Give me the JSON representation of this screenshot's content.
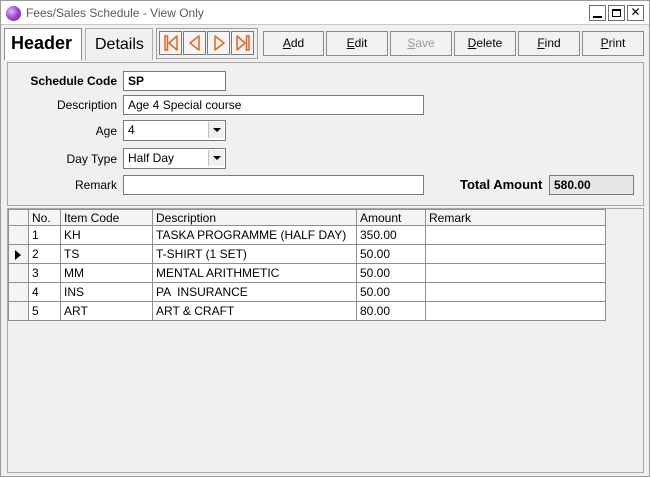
{
  "window": {
    "title": "Fees/Sales Schedule - View Only",
    "controls": [
      "minimize",
      "maximize",
      "close"
    ]
  },
  "tabs": [
    {
      "label": "Header",
      "active": true
    },
    {
      "label": "Details",
      "active": false
    }
  ],
  "navigation": {
    "icons": [
      "first-record-icon",
      "previous-record-icon",
      "next-record-icon",
      "last-record-icon"
    ],
    "icon_color": "#e8641b"
  },
  "toolbar": {
    "add": {
      "label_ul": "A",
      "label_rest": "dd"
    },
    "edit": {
      "label_ul": "E",
      "label_rest": "dit"
    },
    "save": {
      "label_ul": "S",
      "label_rest": "ave",
      "disabled": true
    },
    "delete": {
      "label_ul": "D",
      "label_rest": "elete"
    },
    "find": {
      "label_ul": "F",
      "label_rest": "ind"
    },
    "print": {
      "label_ul": "P",
      "label_rest": "rint"
    }
  },
  "form": {
    "schedule_code": {
      "label": "Schedule Code",
      "value": "SP"
    },
    "description": {
      "label": "Description",
      "value": "Age 4 Special course"
    },
    "age": {
      "label": "Age",
      "value": "4"
    },
    "day_type": {
      "label": "Day Type",
      "value": "Half Day"
    },
    "remark": {
      "label": "Remark",
      "value": ""
    },
    "total_amount": {
      "label": "Total Amount",
      "value": "580.00"
    }
  },
  "grid": {
    "columns": [
      "No.",
      "Item Code",
      "Description",
      "Amount",
      "Remark"
    ],
    "current_row": 2,
    "rows": [
      {
        "no": "1",
        "item_code": "KH",
        "description": "TASKA PROGRAMME (HALF DAY)",
        "amount": "350.00",
        "remark": ""
      },
      {
        "no": "2",
        "item_code": "TS",
        "description": "T-SHIRT (1 SET)",
        "amount": "50.00",
        "remark": ""
      },
      {
        "no": "3",
        "item_code": "MM",
        "description": "MENTAL ARITHMETIC",
        "amount": "50.00",
        "remark": ""
      },
      {
        "no": "4",
        "item_code": "INS",
        "description": "PA  INSURANCE",
        "amount": "50.00",
        "remark": ""
      },
      {
        "no": "5",
        "item_code": "ART",
        "description": "ART & CRAFT",
        "amount": "80.00",
        "remark": ""
      }
    ]
  }
}
